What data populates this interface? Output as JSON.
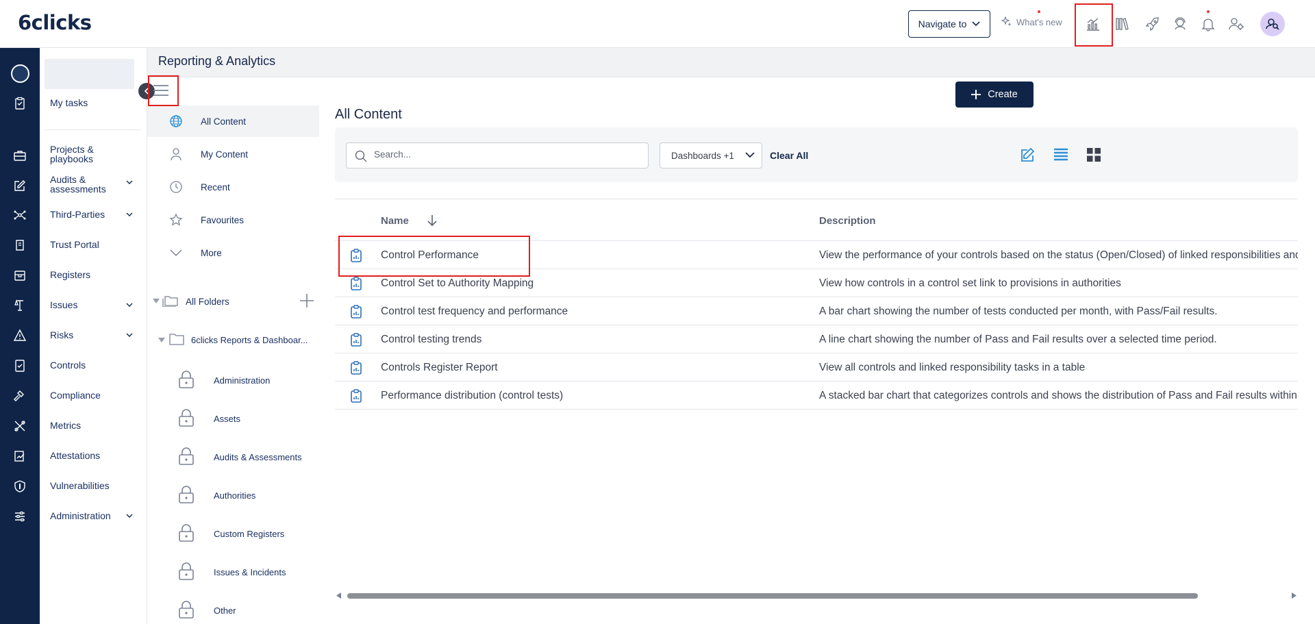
{
  "header": {
    "logo": "6clicks",
    "navigate_label": "Navigate to",
    "whats_new_label": "What's new"
  },
  "nav": {
    "items": [
      {
        "label": "My tasks"
      },
      {
        "label": "Projects & playbooks"
      },
      {
        "label": "Audits & assessments"
      },
      {
        "label": "Third-Parties"
      },
      {
        "label": "Trust Portal"
      },
      {
        "label": "Registers"
      },
      {
        "label": "Issues"
      },
      {
        "label": "Risks"
      },
      {
        "label": "Controls"
      },
      {
        "label": "Compliance"
      },
      {
        "label": "Metrics"
      },
      {
        "label": "Attestations"
      },
      {
        "label": "Vulnerabilities"
      },
      {
        "label": "Administration"
      }
    ]
  },
  "page": {
    "title": "Reporting & Analytics"
  },
  "content_nav": {
    "items": [
      {
        "label": "All Content"
      },
      {
        "label": "My Content"
      },
      {
        "label": "Recent"
      },
      {
        "label": "Favourites"
      },
      {
        "label": "More"
      }
    ],
    "all_folders_label": "All Folders",
    "root_folder_label": "6clicks Reports & Dashboar...",
    "folders": [
      {
        "label": "Administration"
      },
      {
        "label": "Assets"
      },
      {
        "label": "Audits & Assessments"
      },
      {
        "label": "Authorities"
      },
      {
        "label": "Custom Registers"
      },
      {
        "label": "Issues & Incidents"
      },
      {
        "label": "Other"
      }
    ]
  },
  "main": {
    "create_label": "Create",
    "title": "All Content",
    "search_placeholder": "Search...",
    "filter_label": "Dashboards +1",
    "clear_all_label": "Clear All",
    "columns": {
      "name": "Name",
      "description": "Description"
    },
    "rows": [
      {
        "name": "Control Performance",
        "description": "View the performance of your controls based on the status (Open/Closed) of linked responsibilities and"
      },
      {
        "name": "Control Set to Authority Mapping",
        "description": "View how controls in a control set link to provisions in authorities"
      },
      {
        "name": "Control test frequency and performance",
        "description": "A bar chart showing the number of tests conducted per month, with Pass/Fail results."
      },
      {
        "name": "Control testing trends",
        "description": "A line chart showing the number of Pass and Fail results over a selected time period."
      },
      {
        "name": "Controls Register Report",
        "description": "View all controls and linked responsibility tasks in a table"
      },
      {
        "name": "Performance distribution (control tests)",
        "description": "A stacked bar chart that categorizes controls and shows the distribution of Pass and Fail results within"
      }
    ]
  },
  "colors": {
    "navy": "#0f2447",
    "accent_blue": "#2b8fd6",
    "highlight_red": "#e01e1e"
  }
}
